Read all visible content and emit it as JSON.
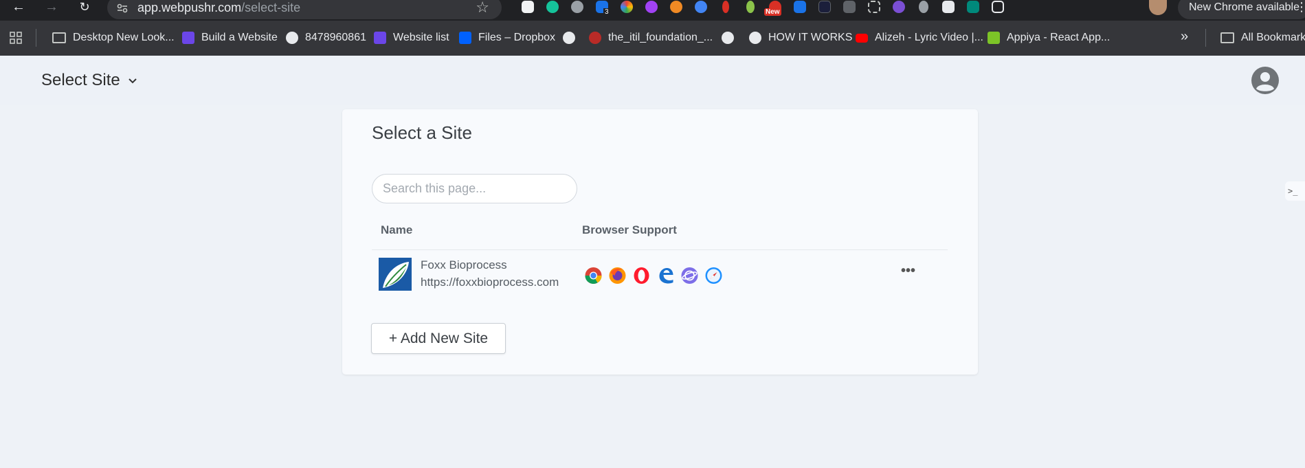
{
  "browser": {
    "url_host": "app.webpushr.com",
    "url_path": "/select-site",
    "new_chrome_label": "New Chrome available",
    "extension_badge_count": "3",
    "extension_new_badge": "New"
  },
  "bookmarks": [
    {
      "label": "Desktop New Look...",
      "icon": "folder-icon"
    },
    {
      "label": "Build a Website",
      "icon": "webflow-icon"
    },
    {
      "label": "8478960861",
      "icon": "globe-icon"
    },
    {
      "label": "Website list",
      "icon": "webflow-icon"
    },
    {
      "label": "Files – Dropbox",
      "icon": "dropbox-icon"
    },
    {
      "label": "",
      "icon": "globe-icon"
    },
    {
      "label": "the_itil_foundation_...",
      "icon": "quora-icon"
    },
    {
      "label": "",
      "icon": "globe-icon"
    },
    {
      "label": "HOW IT WORKS",
      "icon": "globe-icon"
    },
    {
      "label": "Alizeh - Lyric Video |...",
      "icon": "youtube-icon"
    },
    {
      "label": "Appiya - React App...",
      "icon": "appiya-icon"
    },
    {
      "label": "All Bookmarks",
      "icon": "folder-icon"
    }
  ],
  "header": {
    "site_select_label": "Select Site"
  },
  "card": {
    "title": "Select a Site",
    "search_placeholder": "Search this page...",
    "columns": [
      "Name",
      "Browser Support"
    ],
    "rows": [
      {
        "name": "Foxx Bioprocess",
        "url": "https://foxxbioprocess.com",
        "browsers": [
          "chrome-icon",
          "firefox-icon",
          "opera-icon",
          "edge-icon",
          "samsung-internet-icon",
          "safari-icon"
        ],
        "menu_label": "•••"
      }
    ],
    "add_button_label": "+ Add New Site"
  },
  "colors": {
    "page_bg": "#eef2f7",
    "card_bg": "#f8fafd",
    "chrome_dark": "#202124",
    "bookmarks_bar": "#35363a",
    "logo_blue": "#1a5aa6",
    "logo_green": "#2e8b3d"
  }
}
